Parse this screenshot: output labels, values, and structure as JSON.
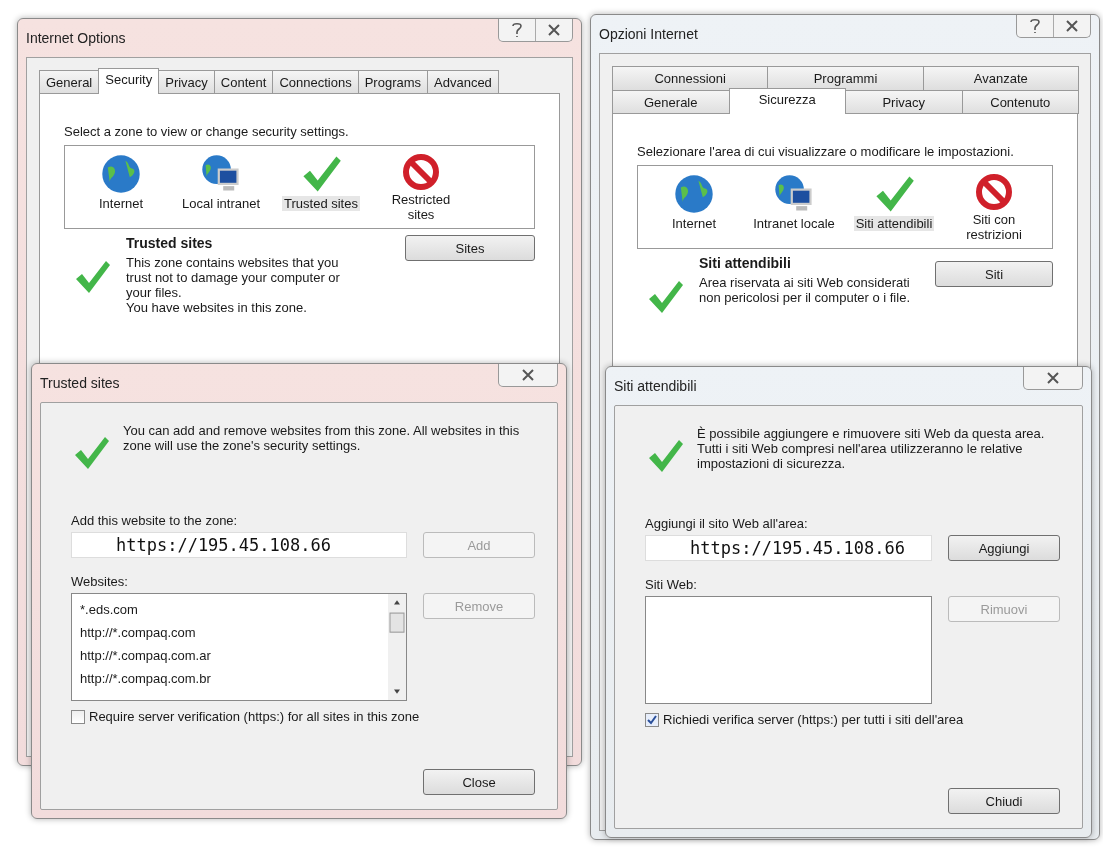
{
  "panels": [
    {
      "window": {
        "title": "Internet Options"
      },
      "tab_rows": [
        [
          {
            "label": "General",
            "selected": false
          },
          {
            "label": "Security",
            "selected": true
          },
          {
            "label": "Privacy",
            "selected": false
          },
          {
            "label": "Content",
            "selected": false
          },
          {
            "label": "Connections",
            "selected": false
          },
          {
            "label": "Programs",
            "selected": false
          },
          {
            "label": "Advanced",
            "selected": false
          }
        ]
      ],
      "zone_prompt": "Select a zone to view or change security settings.",
      "zones": [
        {
          "label": "Internet",
          "kind": "internet",
          "selected": false
        },
        {
          "label": "Local intranet",
          "kind": "intranet",
          "selected": false
        },
        {
          "label": "Trusted sites",
          "kind": "trusted",
          "selected": true
        },
        {
          "label": "Restricted sites",
          "kind": "restricted",
          "selected": false
        }
      ],
      "zone_detail": {
        "title": "Trusted sites",
        "description": "This zone contains websites that you trust not to damage your computer or your files.\nYou have websites in this zone.",
        "button": "Sites"
      },
      "dialog": {
        "title": "Trusted sites",
        "intro": "You can add and remove websites from this zone. All websites in this zone will use the zone's security settings.",
        "add_label": "Add this website to the zone:",
        "add_value": "https://195.45.108.66",
        "add_button": {
          "label": "Add",
          "disabled": true
        },
        "websites_label": "Websites:",
        "websites": [
          "*.eds.com",
          "http://*.compaq.com",
          "http://*.compaq.com.ar",
          "http://*.compaq.com.br"
        ],
        "remove_button": {
          "label": "Remove",
          "disabled": true
        },
        "require_https": {
          "label": "Require server verification (https:) for all sites in this zone",
          "checked": false
        },
        "close_button": "Close"
      }
    },
    {
      "window": {
        "title": "Opzioni Internet"
      },
      "tab_rows": [
        [
          {
            "label": "Connessioni",
            "selected": false
          },
          {
            "label": "Programmi",
            "selected": false
          },
          {
            "label": "Avanzate",
            "selected": false
          }
        ],
        [
          {
            "label": "Generale",
            "selected": false
          },
          {
            "label": "Sicurezza",
            "selected": true
          },
          {
            "label": "Privacy",
            "selected": false
          },
          {
            "label": "Contenuto",
            "selected": false
          }
        ]
      ],
      "zone_prompt": "Selezionare l'area di cui visualizzare o modificare le impostazioni.",
      "zones": [
        {
          "label": "Internet",
          "kind": "internet",
          "selected": false
        },
        {
          "label": "Intranet locale",
          "kind": "intranet",
          "selected": false
        },
        {
          "label": "Siti attendibili",
          "kind": "trusted",
          "selected": true
        },
        {
          "label": "Siti con restrizioni",
          "kind": "restricted",
          "selected": false
        }
      ],
      "zone_detail": {
        "title": "Siti attendibili",
        "description": "Area riservata ai siti Web considerati non pericolosi per il computer o i file.",
        "button": "Siti"
      },
      "dialog": {
        "title": "Siti attendibili",
        "intro": "È possibile aggiungere e rimuovere siti Web da questa area. Tutti i siti Web compresi nell'area utilizzeranno le relative impostazioni di sicurezza.",
        "add_label": "Aggiungi il sito Web all'area:",
        "add_value": "https://195.45.108.66",
        "add_button": {
          "label": "Aggiungi",
          "disabled": false
        },
        "websites_label": "Siti Web:",
        "remove_button": {
          "label": "Rimuovi",
          "disabled": true
        },
        "require_https": {
          "label": "Richiedi verifica server (https:) per tutti i siti dell'area",
          "checked": true
        },
        "close_button": "Chiudi"
      }
    }
  ]
}
